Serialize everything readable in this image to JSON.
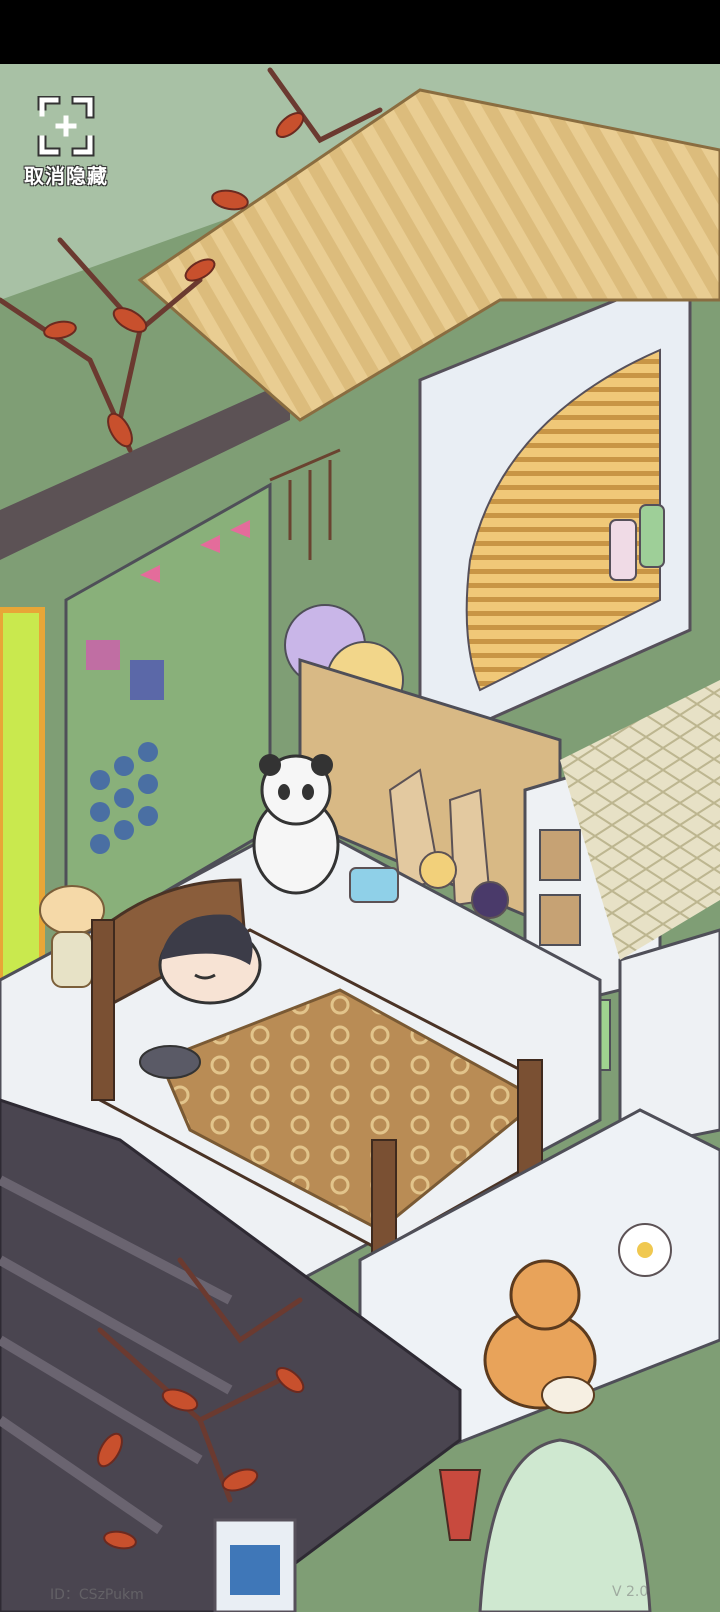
{
  "hud": {
    "unhide_label": "取消隐藏",
    "player_id": "ID：CSzPukm",
    "version": "V 2.0"
  },
  "colors": {
    "wall_green": "#7f9e75",
    "sky": "#a8c1a5",
    "roof": "#e6c98f",
    "floor_white": "#eef1f4",
    "quilt": "#b98c55",
    "leaf_orange": "#c8502d"
  }
}
